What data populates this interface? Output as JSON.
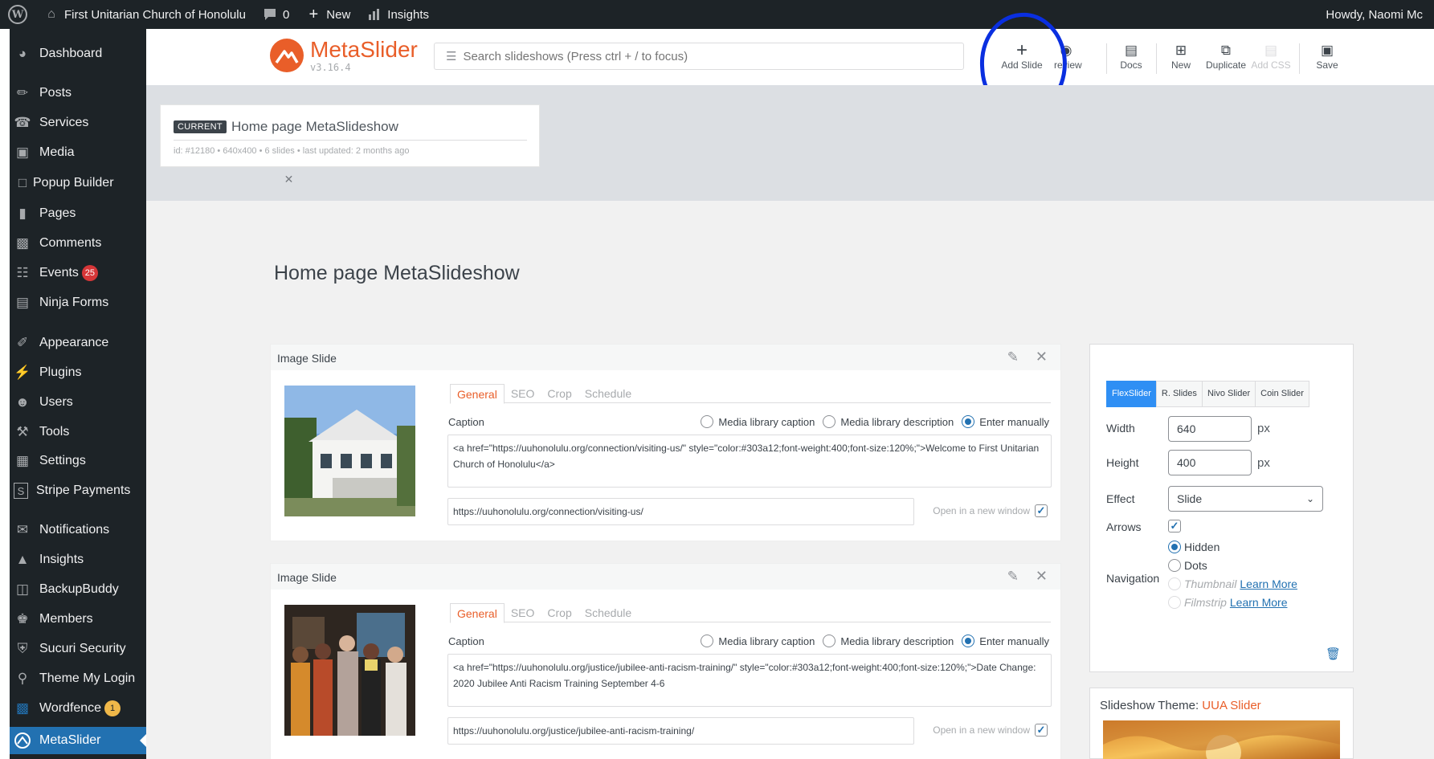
{
  "adminbar": {
    "site_name": "First Unitarian Church of Honolulu",
    "comments_count": "0",
    "new_label": "New",
    "insights_label": "Insights",
    "howdy": "Howdy, Naomi Mc"
  },
  "sidebar": {
    "items": [
      {
        "label": "Dashboard",
        "icon": "dashboard-icon"
      },
      {
        "label": "Posts",
        "icon": "pin-icon"
      },
      {
        "label": "Services",
        "icon": "megaphone-icon"
      },
      {
        "label": "Media",
        "icon": "media-icon"
      },
      {
        "label": "Popup Builder",
        "icon": "popup-icon"
      },
      {
        "label": "Pages",
        "icon": "pages-icon"
      },
      {
        "label": "Comments",
        "icon": "comment-icon"
      },
      {
        "label": "Events",
        "icon": "calendar-icon",
        "badge": "25"
      },
      {
        "label": "Ninja Forms",
        "icon": "form-icon"
      },
      {
        "label": "Appearance",
        "icon": "brush-icon"
      },
      {
        "label": "Plugins",
        "icon": "plugin-icon"
      },
      {
        "label": "Users",
        "icon": "users-icon"
      },
      {
        "label": "Tools",
        "icon": "wrench-icon"
      },
      {
        "label": "Settings",
        "icon": "settings-icon"
      },
      {
        "label": "Stripe Payments",
        "icon": "stripe-icon"
      },
      {
        "label": "Notifications",
        "icon": "mail-icon"
      },
      {
        "label": "Insights",
        "icon": "chart-icon"
      },
      {
        "label": "BackupBuddy",
        "icon": "backup-icon"
      },
      {
        "label": "Members",
        "icon": "members-icon"
      },
      {
        "label": "Sucuri Security",
        "icon": "shield-icon"
      },
      {
        "label": "Theme My Login",
        "icon": "login-icon"
      },
      {
        "label": "Wordfence",
        "icon": "wordfence-icon",
        "badge": "1"
      },
      {
        "label": "MetaSlider",
        "icon": "metaslider-icon",
        "active": true
      }
    ]
  },
  "logo": {
    "name": "MetaSlider",
    "version": "v3.16.4"
  },
  "search": {
    "placeholder": "Search slideshows (Press ctrl + / to focus)"
  },
  "toolbar": {
    "add_slide": "Add Slide",
    "preview": "review",
    "docs": "Docs",
    "new": "New",
    "duplicate": "Duplicate",
    "add_css": "Add CSS",
    "save": "Save"
  },
  "current": {
    "tag": "CURRENT",
    "title": "Home page MetaSlideshow",
    "meta": "id: #12180 • 640x400 • 6 slides • last updated: 2 months ago"
  },
  "page_title": "Home page MetaSlideshow",
  "slide_tabs": [
    "General",
    "SEO",
    "Crop",
    "Schedule"
  ],
  "caption_label": "Caption",
  "caption_options": [
    "Media library caption",
    "Media library description",
    "Enter manually"
  ],
  "open_new_window": "Open in a new window",
  "slides": [
    {
      "type": "Image Slide",
      "caption": "<a href=\"https://uuhonolulu.org/connection/visiting-us/\" style=\"color:#303a12;font-weight:400;font-size:120%;\">Welcome to First Unitarian Church of Honolulu</a>",
      "url": "https://uuhonolulu.org/connection/visiting-us/"
    },
    {
      "type": "Image Slide",
      "caption": "<a href=\"https://uuhonolulu.org/justice/jubilee-anti-racism-training/\" style=\"color:#303a12;font-weight:400;font-size:120%;\">Date Change: 2020 Jubilee Anti Racism Training September 4-6",
      "url": "https://uuhonolulu.org/justice/jubilee-anti-racism-training/"
    }
  ],
  "settings": {
    "libraries": [
      "FlexSlider",
      "R. Slides",
      "Nivo Slider",
      "Coin Slider"
    ],
    "width_label": "Width",
    "width": "640",
    "height_label": "Height",
    "height": "400",
    "unit": "px",
    "effect_label": "Effect",
    "effect": "Slide",
    "arrows_label": "Arrows",
    "navigation_label": "Navigation",
    "nav_options": [
      "Hidden",
      "Dots",
      "Thumbnail",
      "Filmstrip"
    ],
    "learn_more": "Learn More"
  },
  "theme": {
    "label": "Slideshow Theme:",
    "value": "UUA Slider"
  },
  "colors": {
    "accent": "#e95e29",
    "wp_blue": "#2271b1",
    "admin_dark": "#1d2327",
    "annotation": "#0a2fe0"
  }
}
